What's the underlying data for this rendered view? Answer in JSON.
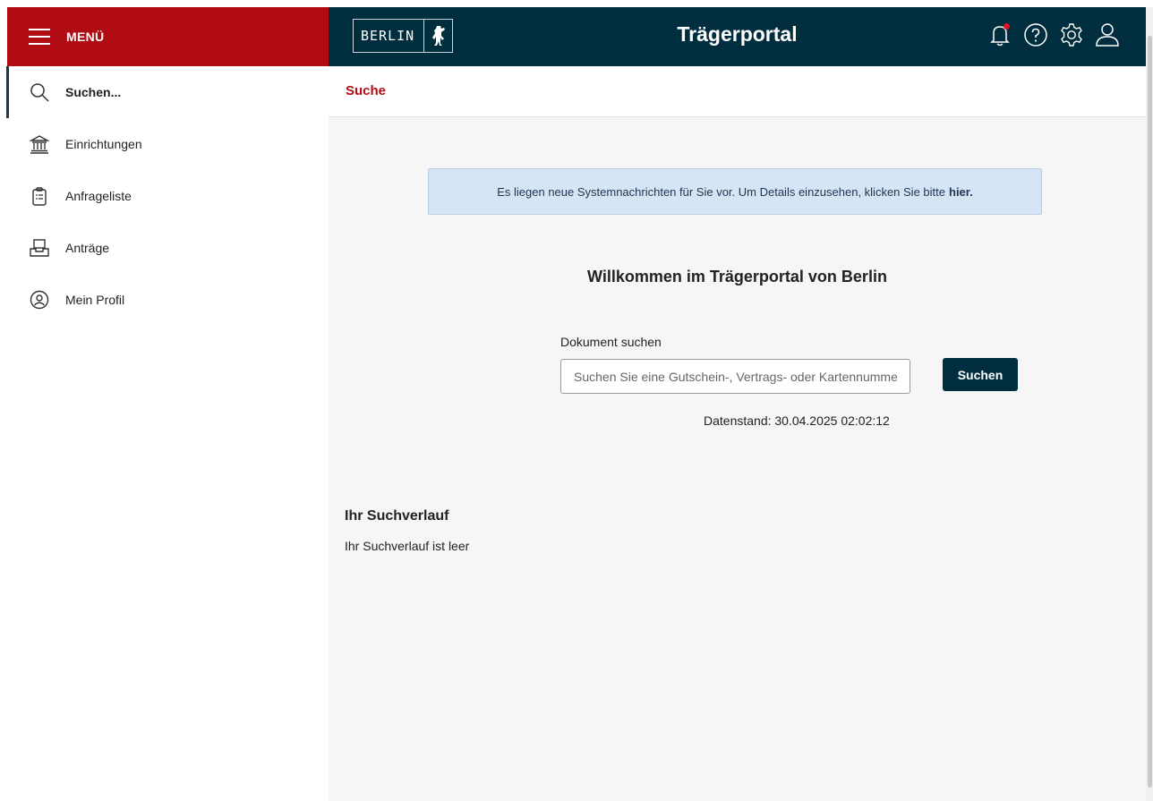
{
  "sidebar": {
    "menu_label": "MENÜ",
    "items": [
      {
        "label": "Suchen...",
        "icon": "search-icon"
      },
      {
        "label": "Einrichtungen",
        "icon": "institution-icon"
      },
      {
        "label": "Anfrageliste",
        "icon": "clipboard-list-icon"
      },
      {
        "label": "Anträge",
        "icon": "inbox-tray-icon"
      },
      {
        "label": "Mein Profil",
        "icon": "profile-icon"
      }
    ]
  },
  "header": {
    "logo_text": "BERLIN",
    "title": "Trägerportal",
    "icons": [
      "bell-icon",
      "help-icon",
      "settings-icon",
      "user-icon"
    ]
  },
  "subheader": {
    "title": "Suche"
  },
  "main": {
    "notice_text": "Es liegen neue Systemnachrichten für Sie vor. Um Details einzusehen, klicken Sie bitte",
    "notice_link": "hier.",
    "welcome": "Willkommen im Trägerportal von Berlin",
    "search_label": "Dokument suchen",
    "search_placeholder": "Suchen Sie eine Gutschein-, Vertrags- oder Kartennummer",
    "search_value": "",
    "search_button": "Suchen",
    "data_status": "Datenstand: 30.04.2025 02:02:12",
    "history_title": "Ihr Suchverlauf",
    "history_empty": "Ihr Suchverlauf ist leer"
  },
  "colors": {
    "menu_red": "#b10b14",
    "header_navy": "#002e3f",
    "notice_blue": "#d6e5f5",
    "notification_dot": "#e2141d"
  }
}
